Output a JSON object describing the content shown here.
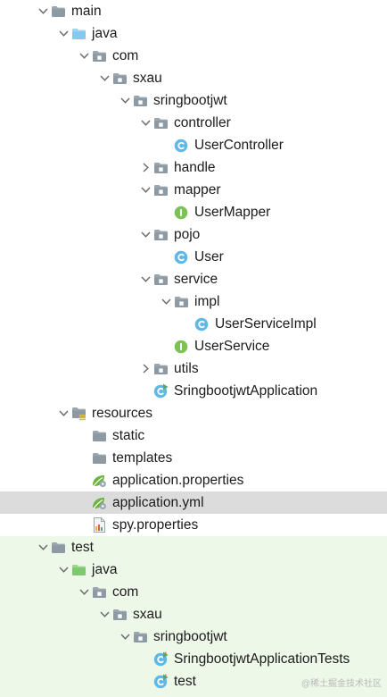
{
  "tree": [
    {
      "label": "main",
      "icon": "folder-icon",
      "depth": 0,
      "arrow": "down"
    },
    {
      "label": "java",
      "icon": "source-folder-icon",
      "depth": 1,
      "arrow": "down"
    },
    {
      "label": "com",
      "icon": "package-icon",
      "depth": 2,
      "arrow": "down"
    },
    {
      "label": "sxau",
      "icon": "package-icon",
      "depth": 3,
      "arrow": "down"
    },
    {
      "label": "sringbootjwt",
      "icon": "package-icon",
      "depth": 4,
      "arrow": "down"
    },
    {
      "label": "controller",
      "icon": "package-icon",
      "depth": 5,
      "arrow": "down"
    },
    {
      "label": "UserController",
      "icon": "class-icon",
      "depth": 6,
      "arrow": "none"
    },
    {
      "label": "handle",
      "icon": "package-icon",
      "depth": 5,
      "arrow": "right"
    },
    {
      "label": "mapper",
      "icon": "package-icon",
      "depth": 5,
      "arrow": "down"
    },
    {
      "label": "UserMapper",
      "icon": "interface-icon",
      "depth": 6,
      "arrow": "none"
    },
    {
      "label": "pojo",
      "icon": "package-icon",
      "depth": 5,
      "arrow": "down"
    },
    {
      "label": "User",
      "icon": "class-icon",
      "depth": 6,
      "arrow": "none"
    },
    {
      "label": "service",
      "icon": "package-icon",
      "depth": 5,
      "arrow": "down"
    },
    {
      "label": "impl",
      "icon": "package-icon",
      "depth": 6,
      "arrow": "down"
    },
    {
      "label": "UserServiceImpl",
      "icon": "class-icon",
      "depth": 7,
      "arrow": "none"
    },
    {
      "label": "UserService",
      "icon": "interface-icon",
      "depth": 6,
      "arrow": "none"
    },
    {
      "label": "utils",
      "icon": "package-icon",
      "depth": 5,
      "arrow": "right"
    },
    {
      "label": "SringbootjwtApplication",
      "icon": "spring-boot-class-icon",
      "depth": 5,
      "arrow": "none"
    },
    {
      "label": "resources",
      "icon": "resources-folder-icon",
      "depth": 1,
      "arrow": "down"
    },
    {
      "label": "static",
      "icon": "folder-icon",
      "depth": 2,
      "arrow": "none"
    },
    {
      "label": "templates",
      "icon": "folder-icon",
      "depth": 2,
      "arrow": "none"
    },
    {
      "label": "application.properties",
      "icon": "spring-config-icon",
      "depth": 2,
      "arrow": "none"
    },
    {
      "label": "application.yml",
      "icon": "spring-config-icon",
      "depth": 2,
      "arrow": "none",
      "selected": true
    },
    {
      "label": "spy.properties",
      "icon": "properties-file-icon",
      "depth": 2,
      "arrow": "none"
    },
    {
      "label": "test",
      "icon": "folder-icon",
      "depth": 0,
      "arrow": "down"
    },
    {
      "label": "java",
      "icon": "test-source-folder-icon",
      "depth": 1,
      "arrow": "down"
    },
    {
      "label": "com",
      "icon": "package-icon",
      "depth": 2,
      "arrow": "down"
    },
    {
      "label": "sxau",
      "icon": "package-icon",
      "depth": 3,
      "arrow": "down"
    },
    {
      "label": "sringbootjwt",
      "icon": "package-icon",
      "depth": 4,
      "arrow": "down"
    },
    {
      "label": "SringbootjwtApplicationTests",
      "icon": "test-class-icon",
      "depth": 5,
      "arrow": "none"
    },
    {
      "label": "test",
      "icon": "test-class-icon",
      "depth": 5,
      "arrow": "none"
    }
  ],
  "watermark": "@稀土掘金技术社区",
  "colors": {
    "selected_row": "#dcdcdc",
    "test_background": "#eef8e8",
    "source_folder": "#87c9ec",
    "test_folder": "#7ec86f",
    "class_badge": "#5fb9e8",
    "interface_badge": "#7ac354"
  }
}
